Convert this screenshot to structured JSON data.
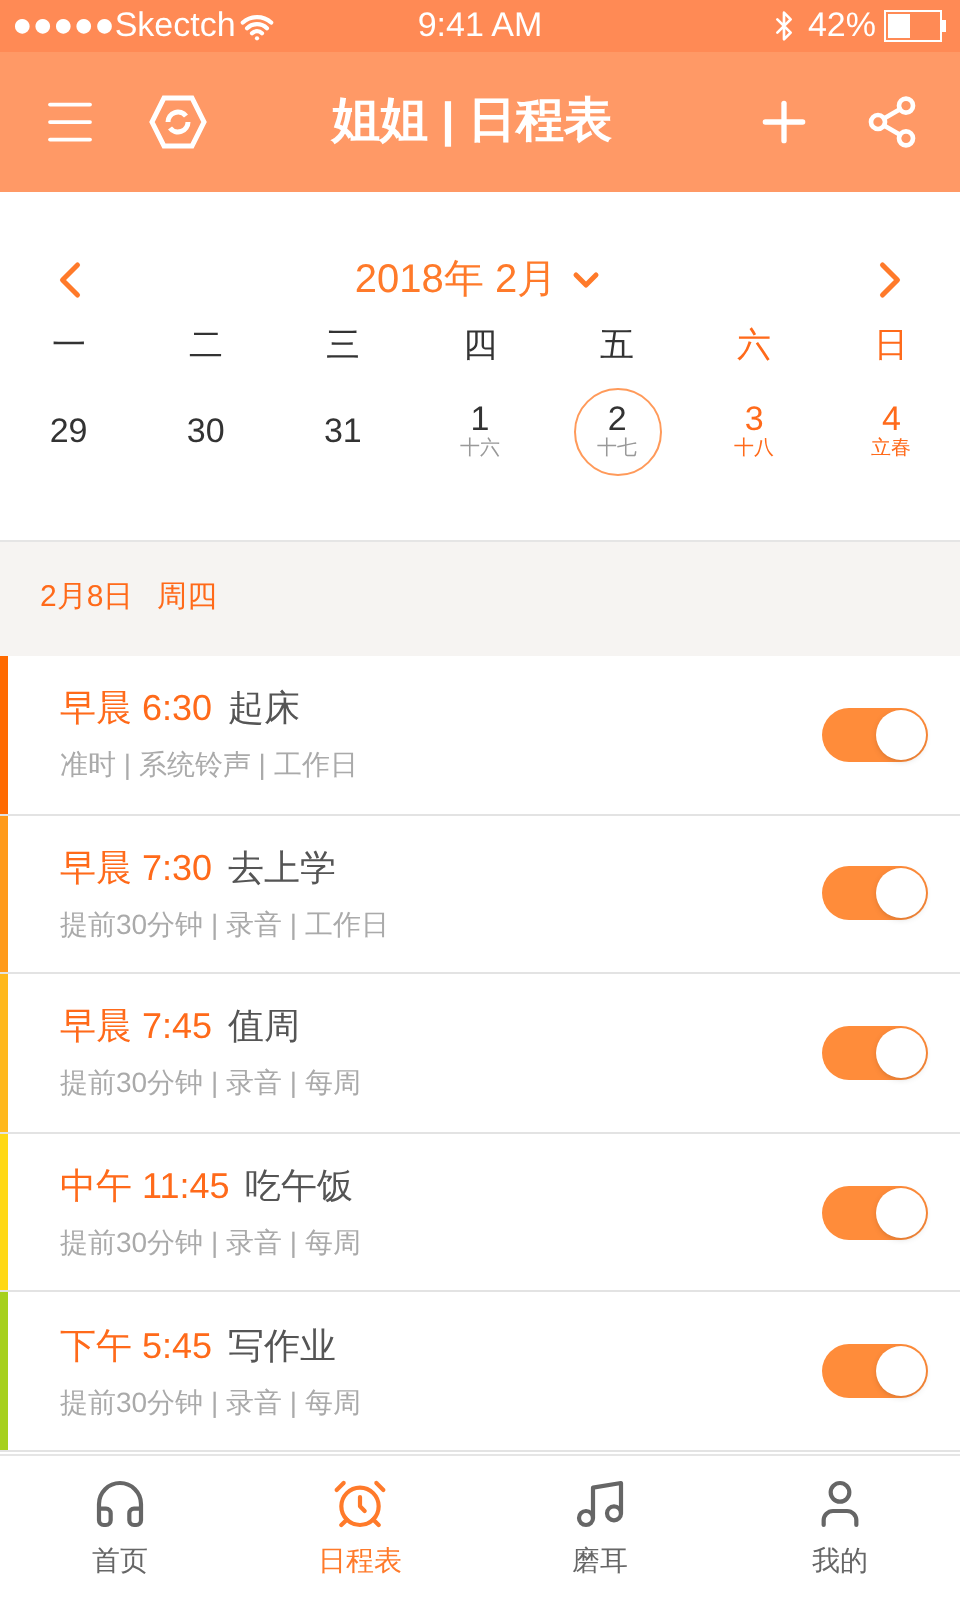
{
  "status_bar": {
    "carrier": "●●●●●Skectch",
    "time": "9:41 AM",
    "battery": "42%"
  },
  "header": {
    "title": "姐姐 | 日程表"
  },
  "calendar": {
    "month": "2018年 2月",
    "weekdays": [
      {
        "label": "一",
        "weekend": false
      },
      {
        "label": "二",
        "weekend": false
      },
      {
        "label": "三",
        "weekend": false
      },
      {
        "label": "四",
        "weekend": false
      },
      {
        "label": "五",
        "weekend": false
      },
      {
        "label": "六",
        "weekend": true
      },
      {
        "label": "日",
        "weekend": true
      }
    ],
    "days": [
      {
        "day": "29",
        "weekend": false,
        "selected": false
      },
      {
        "day": "30",
        "weekend": false,
        "selected": false
      },
      {
        "day": "31",
        "weekend": false,
        "selected": false
      },
      {
        "day": "1",
        "lunar": "十六",
        "weekend": false,
        "selected": false
      },
      {
        "day": "2",
        "lunar": "十七",
        "weekend": false,
        "selected": true
      },
      {
        "day": "3",
        "lunar": "十八",
        "weekend": true,
        "selected": false
      },
      {
        "day": "4",
        "lunar": "立春",
        "weekend": true,
        "selected": false
      }
    ]
  },
  "date_header": {
    "date": "2月8日",
    "weekday": "周四"
  },
  "alarms": [
    {
      "period": "早晨",
      "time": "6:30",
      "title": "起床",
      "details": "准时 | 系统铃声 | 工作日",
      "color": "#ff6a00",
      "on": true
    },
    {
      "period": "早晨",
      "time": "7:30",
      "title": "去上学",
      "details": "提前30分钟 | 录音 | 工作日",
      "color": "#ff9a1a",
      "on": true
    },
    {
      "period": "早晨",
      "time": "7:45",
      "title": "值周",
      "details": "提前30分钟 | 录音 | 每周",
      "color": "#ffb81c",
      "on": true
    },
    {
      "period": "中午",
      "time": "11:45",
      "title": "吃午饭",
      "details": "提前30分钟 | 录音 | 每周",
      "color": "#ffd814",
      "on": true
    },
    {
      "period": "下午",
      "time": "5:45",
      "title": "写作业",
      "details": "提前30分钟 | 录音 | 每周",
      "color": "#a6d01e",
      "on": true
    }
  ],
  "tab_bar": [
    {
      "label": "首页",
      "kind": "home",
      "selected": false
    },
    {
      "label": "日程表",
      "kind": "alarm",
      "selected": true
    },
    {
      "label": "磨耳",
      "kind": "music",
      "selected": false
    },
    {
      "label": "我的",
      "kind": "user",
      "selected": false
    }
  ]
}
